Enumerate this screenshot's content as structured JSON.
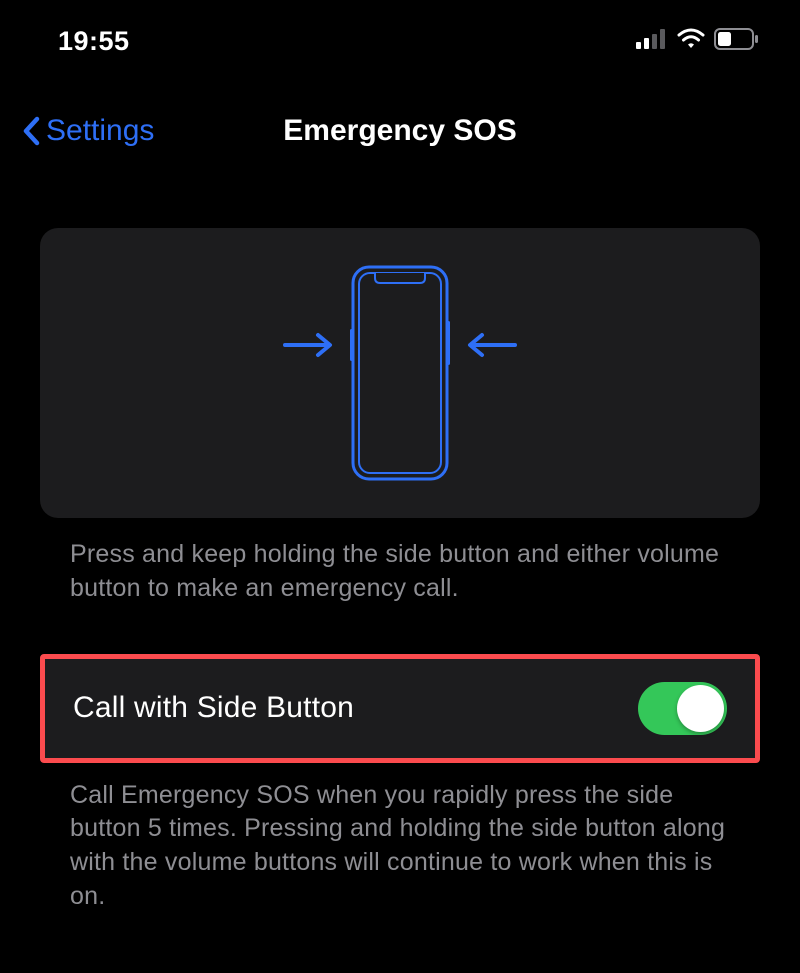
{
  "statusBar": {
    "time": "19:55"
  },
  "nav": {
    "backLabel": "Settings",
    "title": "Emergency SOS"
  },
  "illustration": {
    "helper": "Press and keep holding the side button and either volume button to make an emergency call."
  },
  "setting": {
    "label": "Call with Side Button",
    "enabled": true,
    "helper": "Call Emergency SOS when you rapidly press the side button 5 times. Pressing and holding the side button along with the volume buttons will continue to work when this is on."
  }
}
